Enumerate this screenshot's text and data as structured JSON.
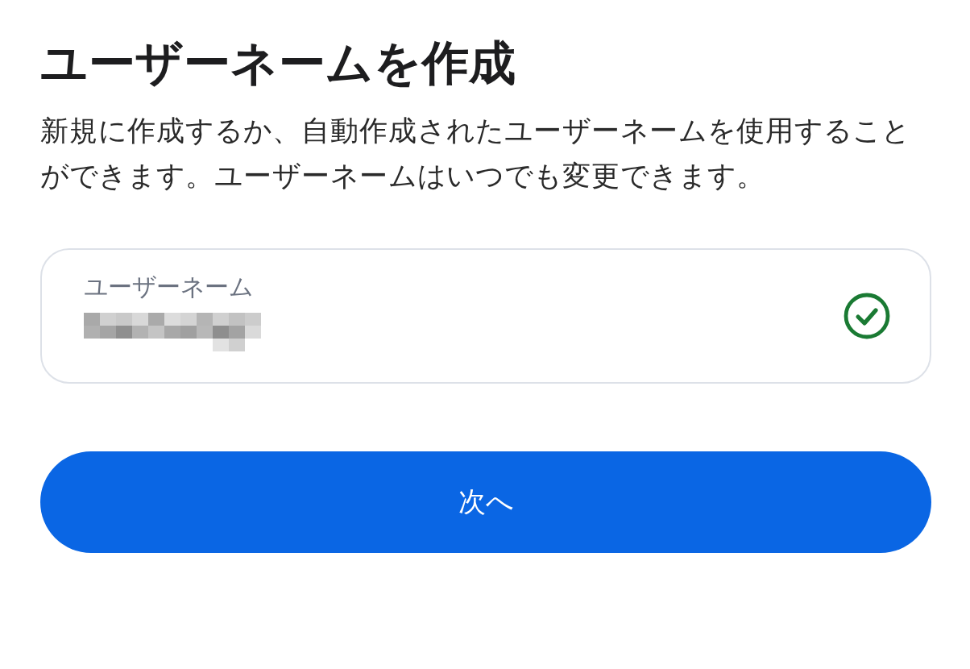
{
  "title": "ユーザーネームを作成",
  "description": "新規に作成するか、自動作成されたユーザーネームを使用することができます。ユーザーネームはいつでも変更できます。",
  "username_field": {
    "label": "ユーザーネーム",
    "value_hidden": true,
    "valid": true
  },
  "next_button": {
    "label": "次へ"
  }
}
